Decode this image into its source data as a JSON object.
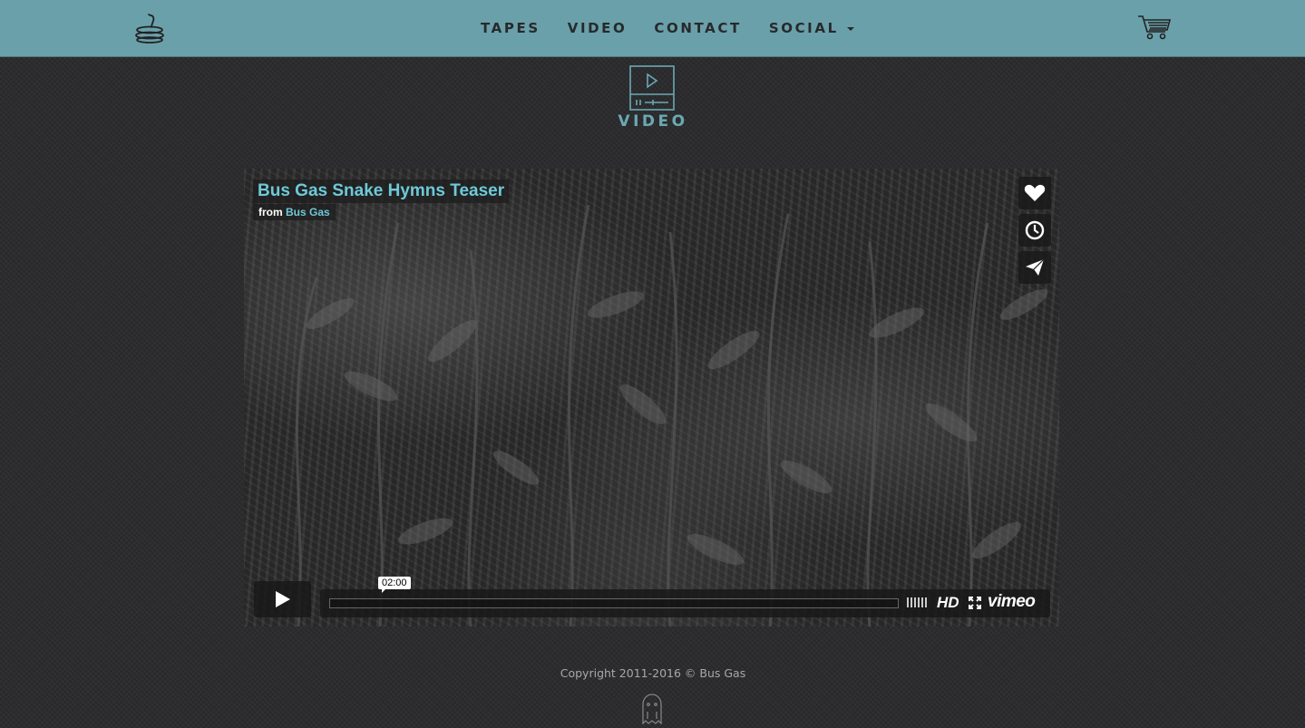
{
  "nav": {
    "items": [
      "TAPES",
      "VIDEO",
      "CONTACT",
      "SOCIAL"
    ],
    "social_has_dropdown": true,
    "logo_icon": "snake-icon",
    "cart_icon": "shopping-cart-icon"
  },
  "section": {
    "icon": "video-player-icon",
    "title": "VIDEO"
  },
  "video": {
    "title": "Bus Gas Snake Hymns Teaser",
    "from_label": "from",
    "author": "Bus Gas",
    "time": "02:00",
    "hd_label": "HD",
    "brand": "vimeo",
    "side_buttons": [
      "heart-icon",
      "clock-icon",
      "paper-plane-icon"
    ]
  },
  "footer": {
    "copyright": "Copyright 2011-2016 © Bus Gas",
    "icon": "ghost-icon"
  },
  "colors": {
    "navbar": "#6aa0aa",
    "background": "#2a2a2c",
    "accent": "#6aa9b3",
    "video_title": "#6ec9d8"
  }
}
